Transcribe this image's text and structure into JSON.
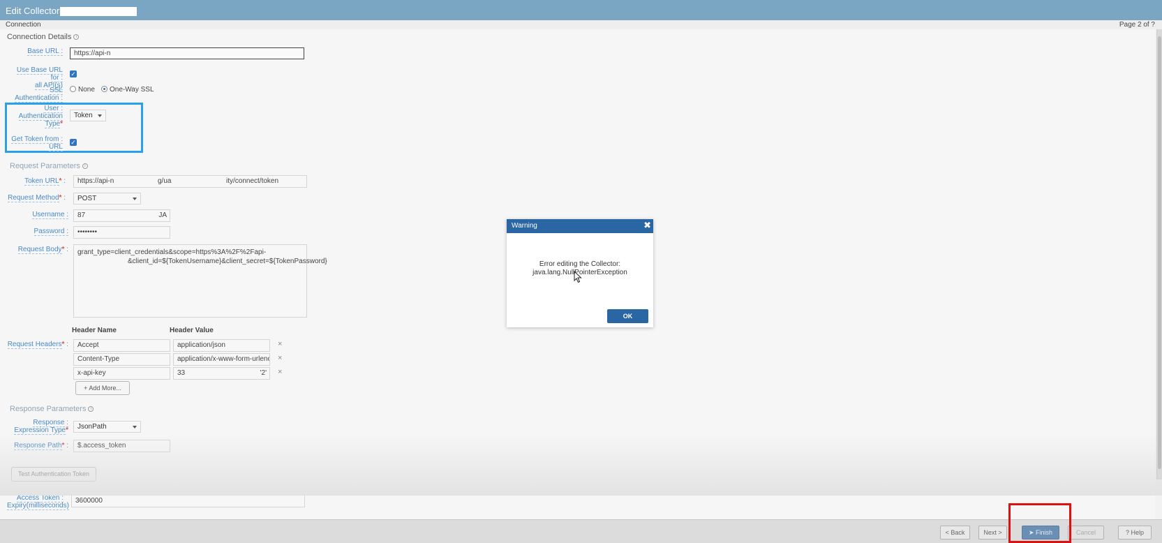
{
  "window": {
    "title": "Edit Collector: I",
    "breadcrumb": "Connection",
    "page_indicator": "Page 2 of ?"
  },
  "connection": {
    "section_title": "Connection Details",
    "base_url_label": "Base URL :",
    "base_url_value": "https://api-n",
    "use_base_url_label_1": "Use Base URL for :",
    "use_base_url_label_2": "all API(s)",
    "ssl_label": "SSL Authentication :",
    "ssl_options": [
      "None",
      "One-Way SSL"
    ],
    "ssl_selected": "One-Way SSL",
    "user_auth_label_1": "User :",
    "user_auth_label_2": "Authentication",
    "user_auth_label_3": "Type",
    "user_auth_value": "Token",
    "get_token_label_1": "Get Token from :",
    "get_token_label_2": "URL"
  },
  "request": {
    "section_title": "Request Parameters",
    "token_url_label": "Token URL",
    "token_url_value_1": "https://api-n",
    "token_url_value_2": "g/ua",
    "token_url_value_3": "ity/connect/token",
    "method_label": "Request Method",
    "method_value": "POST",
    "username_label": "Username :",
    "username_value": "87",
    "username_tail": "JA",
    "password_label": "Password :",
    "password_value": "••••••••",
    "body_label": "Request Body",
    "body_line1": "grant_type=client_credentials&scope=https%3A%2F%2Fapi-",
    "body_line2": "&client_id=${TokenUsername}&client_secret=${TokenPassword}",
    "header_name_col": "Header Name",
    "header_value_col": "Header Value",
    "headers_label": "Request Headers",
    "headers": [
      {
        "name": "Accept",
        "value": "application/json"
      },
      {
        "name": "Content-Type",
        "value": "application/x-www-form-urlencoc"
      },
      {
        "name": "x-api-key",
        "value": "33",
        "value_tail": "'2'"
      }
    ],
    "add_more": "+ Add More..."
  },
  "response": {
    "section_title": "Response Parameters",
    "expr_label_1": "Response :",
    "expr_label_2": "Expression Type",
    "expr_value": "JsonPath",
    "path_label": "Response Path",
    "path_value": "$.access_token",
    "test_button": "Test Authentication Token",
    "expiry_label_1": "Access Token :",
    "expiry_label_2": "Expiry(milliseconds)",
    "expiry_value": "3600000"
  },
  "footer": {
    "back": "< Back",
    "next": "Next >",
    "finish": "➤ Finish",
    "cancel": "Cancel",
    "help": "? Help"
  },
  "dialog": {
    "title": "Warning",
    "close": "✖",
    "message_line1": "Error editing the Collector:",
    "message_line2": "java.lang.NullPointerException",
    "ok": "OK"
  }
}
